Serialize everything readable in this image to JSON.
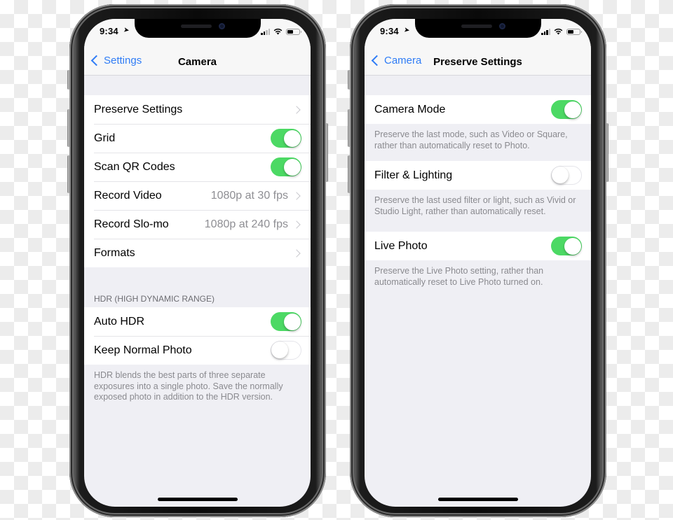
{
  "colors": {
    "accent": "#2f7cf6",
    "toggle_on": "#4cd964",
    "background": "#efeff4"
  },
  "left_phone": {
    "status": {
      "time": "9:34",
      "location_icon": "location-arrow-icon",
      "signal_icon": "cellular-signal-icon",
      "wifi_icon": "wifi-icon",
      "battery_icon": "battery-icon"
    },
    "nav": {
      "back_label": "Settings",
      "title": "Camera"
    },
    "group1": [
      {
        "label": "Preserve Settings",
        "value": "",
        "type": "disclosure"
      },
      {
        "label": "Grid",
        "type": "toggle",
        "on": true
      },
      {
        "label": "Scan QR Codes",
        "type": "toggle",
        "on": true
      },
      {
        "label": "Record Video",
        "value": "1080p at 30 fps",
        "type": "disclosure"
      },
      {
        "label": "Record Slo-mo",
        "value": "1080p at 240 fps",
        "type": "disclosure"
      },
      {
        "label": "Formats",
        "value": "",
        "type": "disclosure"
      }
    ],
    "hdr_header": "HDR (HIGH DYNAMIC RANGE)",
    "group2": [
      {
        "label": "Auto HDR",
        "type": "toggle",
        "on": true
      },
      {
        "label": "Keep Normal Photo",
        "type": "toggle",
        "on": false
      }
    ],
    "hdr_footer": "HDR blends the best parts of three separate exposures into a single photo. Save the normally exposed photo in addition to the HDR version."
  },
  "right_phone": {
    "status": {
      "time": "9:34"
    },
    "nav": {
      "back_label": "Camera",
      "title": "Preserve Settings"
    },
    "settings": [
      {
        "label": "Camera Mode",
        "on": true,
        "footer": "Preserve the last mode, such as Video or Square, rather than automatically reset to Photo."
      },
      {
        "label": "Filter & Lighting",
        "on": false,
        "footer": "Preserve the last used filter or light, such as Vivid or Studio Light, rather than automatically reset."
      },
      {
        "label": "Live Photo",
        "on": true,
        "footer": "Preserve the Live Photo setting, rather than automatically reset to Live Photo turned on."
      }
    ]
  }
}
